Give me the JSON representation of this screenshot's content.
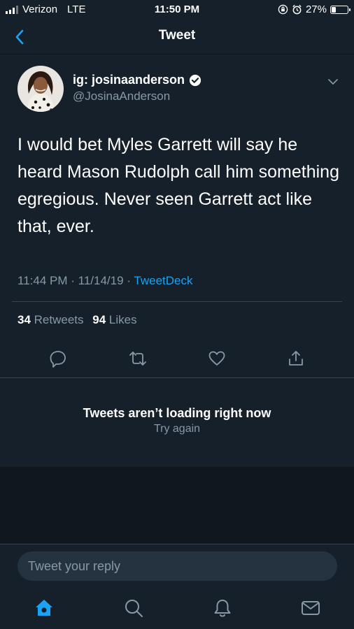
{
  "status_bar": {
    "carrier": "Verizon",
    "network": "LTE",
    "time": "11:50 PM",
    "battery_percent": "27%",
    "battery_level": 0.27,
    "icons": [
      "signal-icon",
      "lock-rotation-icon",
      "alarm-icon",
      "battery-icon"
    ]
  },
  "header": {
    "title": "Tweet",
    "back_icon": "chevron-left-icon"
  },
  "tweet": {
    "display_name": "ig: josinaanderson",
    "handle": "@JosinaAnderson",
    "verified": true,
    "text": "I would bet Myles Garrett will say he heard Mason Rudolph call him something egregious. Never seen Garrett act like that, ever.",
    "time": "11:44 PM",
    "date": "11/14/19",
    "separator": "·",
    "source": "TweetDeck",
    "retweets_count": "34",
    "retweets_label": "Retweets",
    "likes_count": "94",
    "likes_label": "Likes",
    "actions": [
      "reply-icon",
      "retweet-icon",
      "like-icon",
      "share-icon"
    ]
  },
  "replies": {
    "error_title": "Tweets aren’t loading right now",
    "retry_label": "Try again"
  },
  "reply_bar": {
    "placeholder": "Tweet your reply"
  },
  "tab_bar": {
    "items": [
      "home-icon",
      "search-icon",
      "notifications-icon",
      "messages-icon"
    ],
    "active": "home-icon"
  },
  "colors": {
    "background": "#15202b",
    "accent": "#1da1f2",
    "secondary_text": "#8899a6",
    "divider": "#38444d"
  }
}
